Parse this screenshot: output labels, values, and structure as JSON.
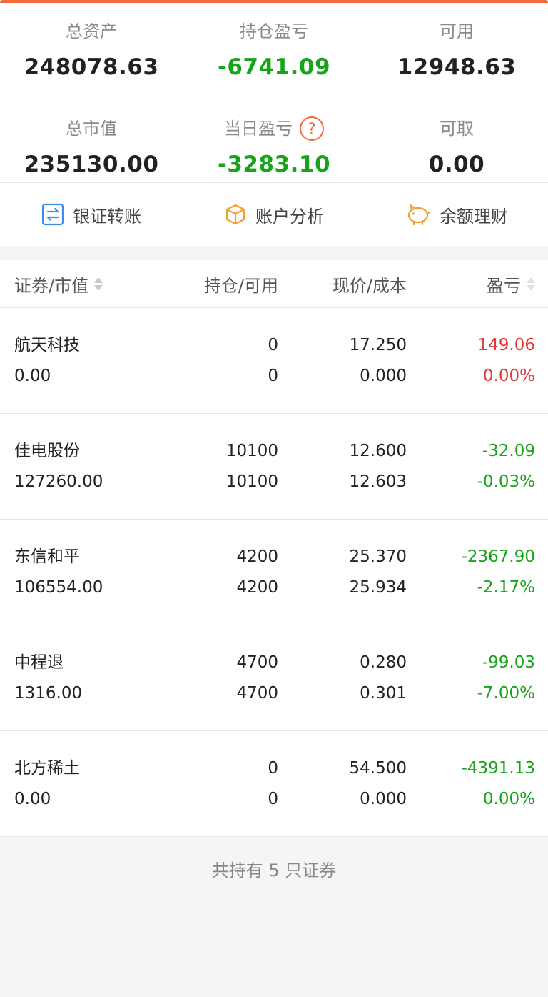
{
  "summary": {
    "total_assets_label": "总资产",
    "total_assets_value": "248078.63",
    "position_pnl_label": "持仓盈亏",
    "position_pnl_value": "-6741.09",
    "available_label": "可用",
    "available_value": "12948.63",
    "market_value_label": "总市值",
    "market_value_value": "235130.00",
    "daily_pnl_label": "当日盈亏",
    "daily_pnl_value": "-3283.10",
    "withdrawable_label": "可取",
    "withdrawable_value": "0.00",
    "help_glyph": "?"
  },
  "actions": {
    "bank_transfer": "银证转账",
    "account_analysis": "账户分析",
    "balance_finance": "余额理财"
  },
  "table": {
    "headers": {
      "security": "证券/市值",
      "position": "持仓/可用",
      "price": "现价/成本",
      "pnl": "盈亏"
    },
    "rows": [
      {
        "name": "航天科技",
        "market_value": "0.00",
        "position": "0",
        "available": "0",
        "price": "17.250",
        "cost": "0.000",
        "pnl": "149.06",
        "pnl_pct": "0.00%",
        "pnl_color": "red",
        "pct_color": "red"
      },
      {
        "name": "佳电股份",
        "market_value": "127260.00",
        "position": "10100",
        "available": "10100",
        "price": "12.600",
        "cost": "12.603",
        "pnl": "-32.09",
        "pnl_pct": "-0.03%",
        "pnl_color": "green",
        "pct_color": "green"
      },
      {
        "name": "东信和平",
        "market_value": "106554.00",
        "position": "4200",
        "available": "4200",
        "price": "25.370",
        "cost": "25.934",
        "pnl": "-2367.90",
        "pnl_pct": "-2.17%",
        "pnl_color": "green",
        "pct_color": "green"
      },
      {
        "name": "中程退",
        "market_value": "1316.00",
        "position": "4700",
        "available": "4700",
        "price": "0.280",
        "cost": "0.301",
        "pnl": "-99.03",
        "pnl_pct": "-7.00%",
        "pnl_color": "green",
        "pct_color": "green"
      },
      {
        "name": "北方稀土",
        "market_value": "0.00",
        "position": "0",
        "available": "0",
        "price": "54.500",
        "cost": "0.000",
        "pnl": "-4391.13",
        "pnl_pct": "0.00%",
        "pnl_color": "green",
        "pct_color": "green"
      }
    ]
  },
  "footer": {
    "text": "共持有 5 只证券"
  },
  "colors": {
    "accent": "#f06a3a",
    "gain": "#e4393c",
    "loss": "#17a31a"
  }
}
